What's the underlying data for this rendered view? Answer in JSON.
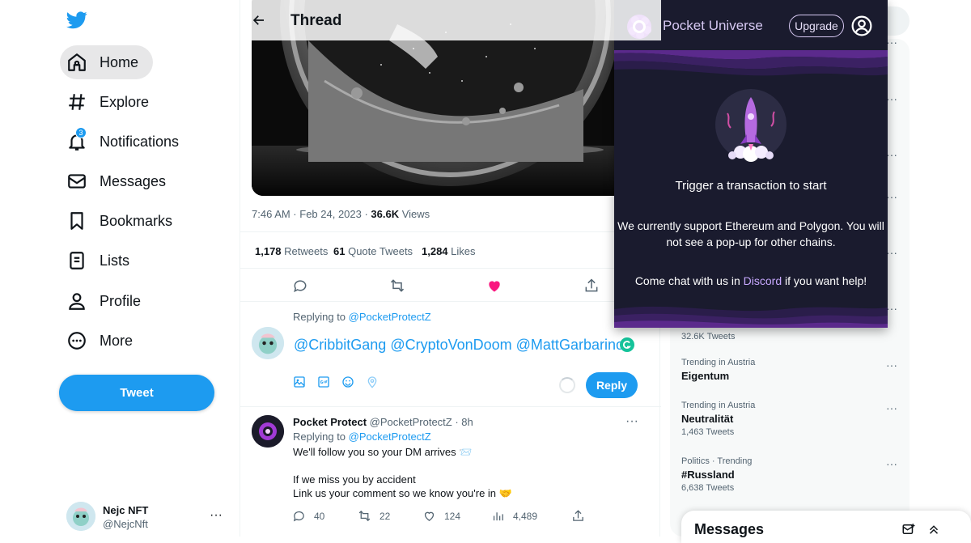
{
  "nav": {
    "items": [
      {
        "label": "Home",
        "icon": "home-icon"
      },
      {
        "label": "Explore",
        "icon": "hashtag-icon"
      },
      {
        "label": "Notifications",
        "icon": "bell-icon",
        "badge": "3"
      },
      {
        "label": "Messages",
        "icon": "envelope-icon"
      },
      {
        "label": "Bookmarks",
        "icon": "bookmark-icon"
      },
      {
        "label": "Lists",
        "icon": "list-icon"
      },
      {
        "label": "Profile",
        "icon": "person-icon"
      },
      {
        "label": "More",
        "icon": "more-circle-icon"
      }
    ],
    "tweet_button": "Tweet",
    "account": {
      "name": "Nejc NFT",
      "handle": "@NejcNft",
      "more": "···"
    }
  },
  "thread": {
    "title": "Thread",
    "time": "7:46 AM · Feb 24, 2023 · ",
    "views_count": "36.6K",
    "views_label": " Views",
    "stats": [
      {
        "n": "1,178",
        "label": " Retweets"
      },
      {
        "n": "61",
        "label": " Quote Tweets"
      },
      {
        "n": "1,284",
        "label": " Likes"
      }
    ],
    "composer": {
      "replying_prefix": "Replying to ",
      "replying_handle": "@PocketProtectZ",
      "text": "@CribbitGang @CryptoVonDoom @MattGarbarino",
      "reply_button": "Reply"
    },
    "reply": {
      "name": "Pocket Protect",
      "handle_time": " @PocketProtectZ · 8h",
      "replying_prefix": "Replying to ",
      "replying_handle": "@PocketProtectZ",
      "line1": "We'll follow you so your DM arrives 📨",
      "line2": "If we miss you by accident",
      "line3": "Link us your comment so we know you're in 🤝",
      "counts": {
        "replies": "40",
        "retweets": "22",
        "likes": "124",
        "views": "4,489"
      },
      "more": "···"
    }
  },
  "trends": [
    {
      "ctx": "",
      "title": "",
      "count": "32.6K Tweets"
    },
    {
      "ctx": "Trending in Austria",
      "title": "Eigentum",
      "count": ""
    },
    {
      "ctx": "Trending in Austria",
      "title": "Neutralität",
      "count": "1,463 Tweets"
    },
    {
      "ctx": "Politics · Trending",
      "title": "#Russland",
      "count": "6,638 Tweets"
    }
  ],
  "messages_drawer": {
    "title": "Messages"
  },
  "pocket_universe": {
    "title": "Pocket Universe",
    "upgrade": "Upgrade",
    "headline": "Trigger a transaction to start",
    "support_line1": "We currently support Ethereum and Polygon. You will",
    "support_line2": "not see a pop-up for other chains.",
    "chat_prefix": "Come chat with us in ",
    "chat_link": "Discord",
    "chat_suffix": " if you want help!"
  },
  "colors": {
    "accent": "#1d9bf0",
    "like": "#f91880",
    "popup_bg": "#1a1b2e",
    "popup_purple": "#7b3fe4"
  }
}
